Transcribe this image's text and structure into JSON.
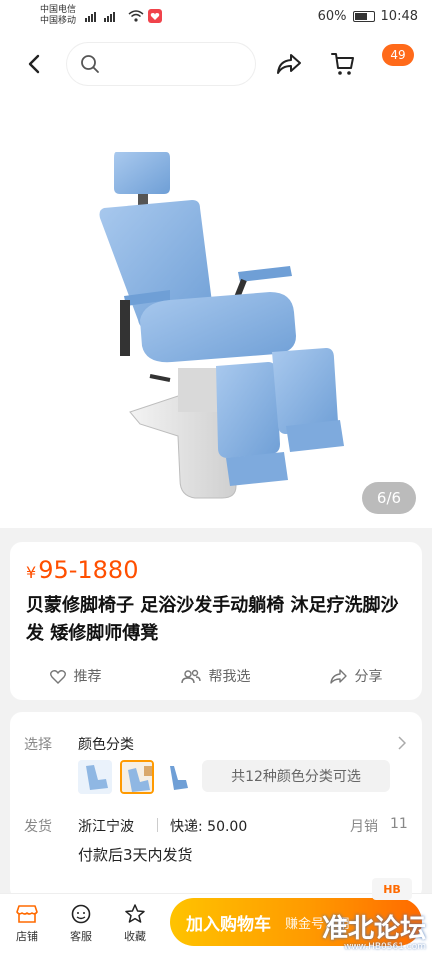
{
  "status_bar": {
    "carrier_1": "中国电信",
    "carrier_2": "中国移动",
    "battery": "60%",
    "time": "10:48"
  },
  "nav": {
    "search_placeholder": "",
    "cart_badge": "49"
  },
  "gallery": {
    "counter": "6/6",
    "image_icon": "blue-pedicure-chair"
  },
  "product": {
    "currency": "¥",
    "price": "95-1880",
    "title": "贝蒙修脚椅子 足浴沙发手动躺椅 沐足疗洗脚沙发 矮修脚师傅凳",
    "actions": [
      {
        "label": "推荐",
        "icon": "heart-icon"
      },
      {
        "label": "帮我选",
        "icon": "people-icon"
      },
      {
        "label": "分享",
        "icon": "share-icon"
      }
    ]
  },
  "spec": {
    "select_label": "选择",
    "select_value": "颜色分类",
    "variants_chip": "共12种颜色分类可选",
    "ship_label": "发货",
    "ship_from": "浙江宁波",
    "express": "快递: 50.00",
    "monthly_sales_label": "月销",
    "monthly_sales": "11",
    "ship_time": "付款后3天内发货"
  },
  "bottom": {
    "tabs": [
      {
        "label": "店铺",
        "icon": "store-icon"
      },
      {
        "label": "客服",
        "icon": "chat-icon"
      },
      {
        "label": "收藏",
        "icon": "star-icon"
      }
    ],
    "add_to_cart": "加入购物车",
    "overlay_text": "赚金号：用",
    "watermark": "准北论坛",
    "watermark_url": "www.HB0561.com",
    "watermark_logo": "HB"
  },
  "colors": {
    "accent": "#ff4f00",
    "badge": "#ff6a1a",
    "chair_blue": "#8fb7e3"
  }
}
